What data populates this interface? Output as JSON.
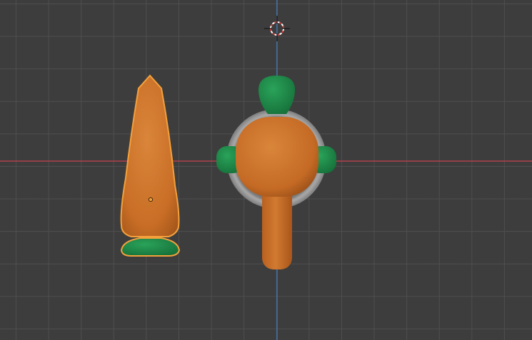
{
  "viewport": {
    "view": "3D Viewport",
    "colors": {
      "background": "#3d3d3d",
      "grid_line": "#505050",
      "x_axis": "#c5434b",
      "z_axis": "#3a80c9",
      "object_orange": "#d4782f",
      "object_green": "#1f8a49",
      "ring_grey": "#9a9a9a",
      "selection_outline": "#f4a13c"
    }
  },
  "scene": {
    "objects": [
      {
        "id": "carrot-side",
        "selected": true,
        "icon": "carrot-mesh"
      },
      {
        "id": "carrot-top",
        "selected": false,
        "icon": "carrot-mesh"
      }
    ],
    "cursor_icon": "3d-cursor-icon"
  }
}
